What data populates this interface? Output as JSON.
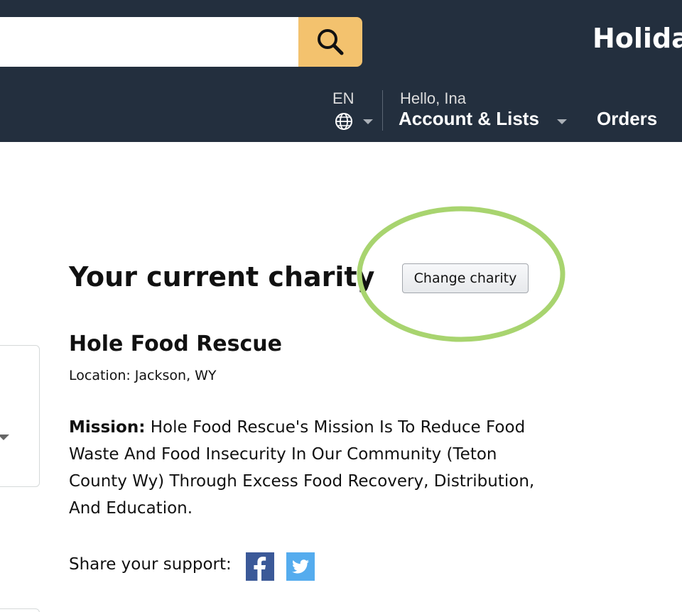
{
  "header": {
    "search": {
      "value": "",
      "placeholder": ""
    },
    "search_icon": "magnifier-icon",
    "banner_text": "Holida",
    "language": {
      "code": "EN",
      "icon": "globe-icon"
    },
    "account": {
      "greeting": "Hello, Ina",
      "label": "Account & Lists"
    },
    "orders_label": "Orders"
  },
  "charity": {
    "section_title": "Your current charity",
    "change_button_label": "Change charity",
    "name": "Hole Food Rescue",
    "location": "Location: Jackson, WY",
    "mission_label": "Mission:",
    "mission_text": " Hole Food Rescue's Mission Is To Reduce Food Waste And Food Insecurity In Our Community (Teton County Wy) Through Excess Food Recovery, Distribution, And Education.",
    "share_label": "Share your support:",
    "social": [
      {
        "name": "Facebook",
        "icon": "facebook-icon",
        "color": "#3b5998"
      },
      {
        "name": "Twitter",
        "icon": "twitter-icon",
        "color": "#55acee"
      }
    ]
  },
  "colors": {
    "header_bg": "#232f3e",
    "search_button": "#f3c26e",
    "highlight_ring": "#a8d46f"
  }
}
